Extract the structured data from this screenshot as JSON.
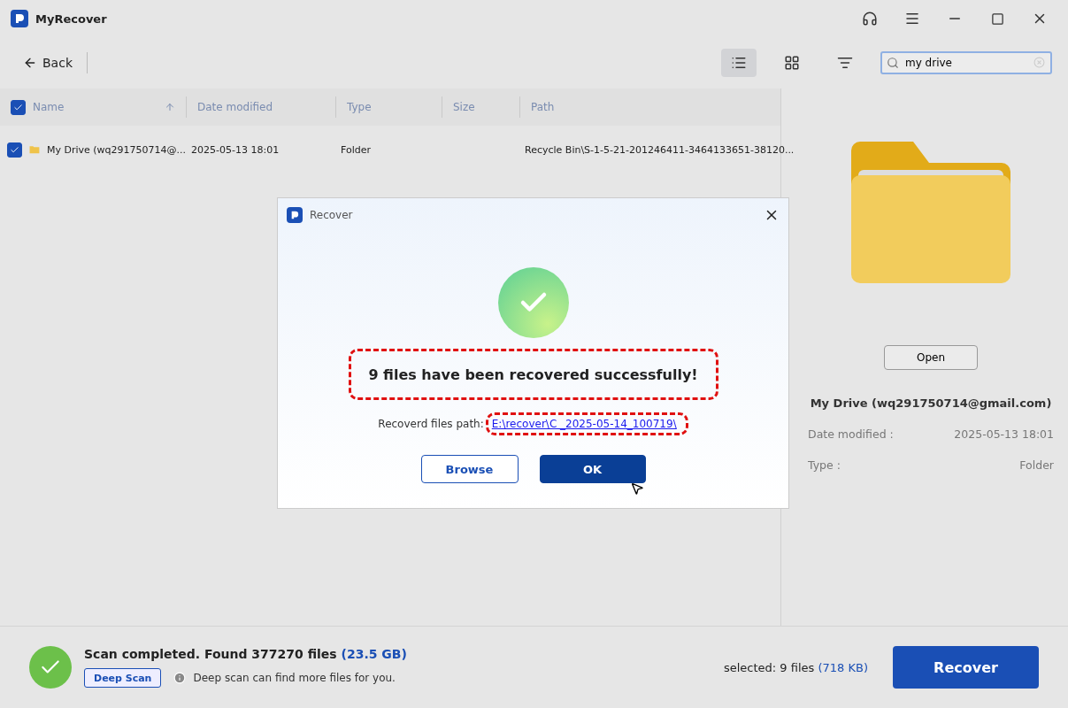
{
  "window": {
    "title": "MyRecover"
  },
  "toolbar": {
    "back": "Back",
    "views": [
      {
        "kind": "list",
        "selected": true
      },
      {
        "kind": "grid",
        "selected": false
      }
    ],
    "search": {
      "value": "my drive"
    }
  },
  "table": {
    "all_checked": true,
    "columns": [
      {
        "label": "Name",
        "sorted": true
      },
      {
        "label": "Date modified",
        "sorted": false
      },
      {
        "label": "Type",
        "sorted": false
      },
      {
        "label": "Size",
        "sorted": false
      },
      {
        "label": "Path",
        "sorted": false
      }
    ],
    "rows": [
      {
        "checked": true,
        "name": "My Drive (wq291750714@...",
        "date": "2025-05-13 18:01",
        "type": "Folder",
        "size": "",
        "path": "Recycle Bin\\S-1-5-21-201246411-3464133651-38120..."
      }
    ]
  },
  "preview": {
    "open": "Open",
    "title": "My Drive (wq291750714@gmail.com)",
    "fields": [
      {
        "label": "Date modified :",
        "value": "2025-05-13 18:01"
      },
      {
        "label": "Type :",
        "value": "Folder"
      }
    ]
  },
  "status": {
    "message": "Scan completed. Found 377270 files",
    "size": "(23.5 GB)",
    "deep_scan": "Deep Scan",
    "hint": "Deep scan can find more files for you.",
    "selected": "selected: 9 files",
    "selected_size": "(718 KB)",
    "recover": "Recover"
  },
  "dialog": {
    "title": "Recover",
    "message": "9 files have been recovered successfully!",
    "path_label": "Recoverd files path:",
    "path": "E:\\recover\\C _2025-05-14_100719\\",
    "buttons": [
      {
        "label": "Browse",
        "kind": "secondary"
      },
      {
        "label": "OK",
        "kind": "primary"
      }
    ]
  }
}
